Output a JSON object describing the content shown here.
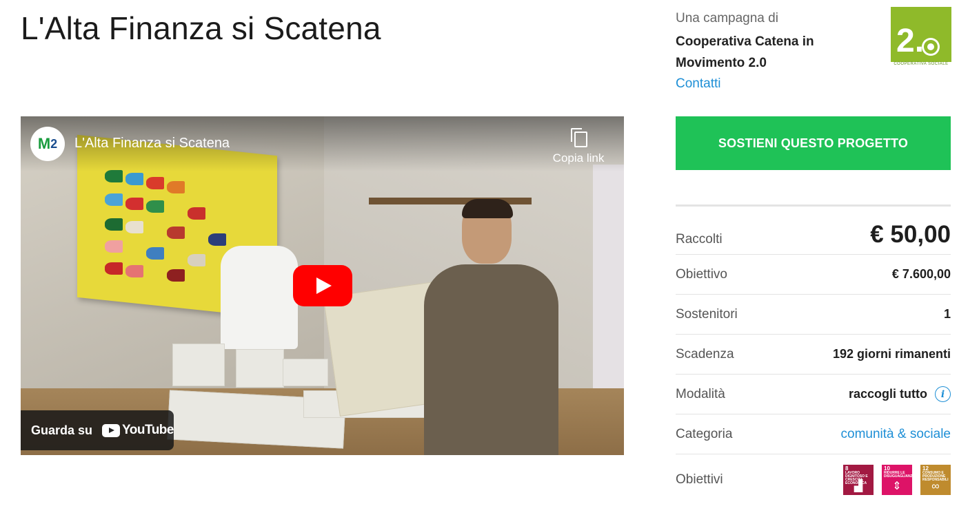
{
  "page": {
    "title": "L'Alta Finanza si Scatena"
  },
  "video": {
    "title": "L'Alta Finanza si Scatena",
    "channel_initials": "M",
    "channel_initials_suffix": "2",
    "copy_link_label": "Copia link",
    "watch_on_label": "Guarda su",
    "youtube_label": "YouTube"
  },
  "campaign": {
    "campaign_of_label": "Una campagna di",
    "organization": "Cooperativa Catena in Movimento 2.0",
    "contacts_label": "Contatti",
    "logo_text": "2.",
    "logo_caption": "COOPERATIVA SOCIALE",
    "support_button": "SOSTIENI QUESTO PROGETTO"
  },
  "stats": {
    "raised_label": "Raccolti",
    "raised_value": "€ 50,00",
    "goal_label": "Obiettivo",
    "goal_value": "€ 7.600,00",
    "backers_label": "Sostenitori",
    "backers_value": "1",
    "deadline_label": "Scadenza",
    "deadline_value": "192 giorni rimanenti",
    "mode_label": "Modalità",
    "mode_value": "raccogli tutto",
    "category_label": "Categoria",
    "category_value": "comunità & sociale",
    "goals_label": "Obiettivi"
  },
  "sdg_goals": [
    {
      "number": "8",
      "text": "LAVORO DIGNITOSO E CRESCITA ECONOMICA",
      "color": "#a21942",
      "glyph": "▟",
      "icon": "growth-chart-icon"
    },
    {
      "number": "10",
      "text": "RIDURRE LE DISUGUAGLIANZE",
      "color": "#dd1367",
      "glyph": "⇕",
      "icon": "equality-icon"
    },
    {
      "number": "12",
      "text": "CONSUMO E PRODUZIONE RESPONSABILI",
      "color": "#bf8b2e",
      "glyph": "∞",
      "icon": "infinity-icon"
    }
  ],
  "colors": {
    "accent_green": "#1fc257",
    "link_blue": "#1e8fd6",
    "youtube_red": "#ff0000",
    "logo_green": "#8fba2a"
  }
}
